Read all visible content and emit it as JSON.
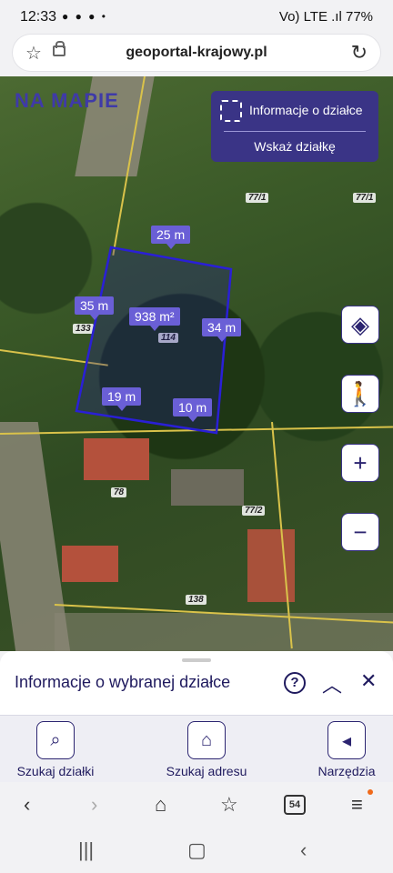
{
  "status": {
    "time": "12:33",
    "notifications": "● ● ● •",
    "right": "Vo) LTE .ıl 77%"
  },
  "browser": {
    "url": "geoportal-krajowy.pl",
    "tabs_count": "54"
  },
  "map": {
    "logo": "NA MAPIE",
    "info_panel": {
      "title": "Informacje o działce",
      "subtitle": "Wskaż działkę"
    },
    "measurements": {
      "top": "25 m",
      "left": "35 m",
      "area": "938 m²",
      "right": "34 m",
      "bottom_left": "19 m",
      "bottom_right": "10 m"
    },
    "plot_numbers": [
      "77/1",
      "77/1",
      "133",
      "114",
      "78",
      "77/2",
      "138"
    ]
  },
  "sheet": {
    "title": "Informacje o wybranej działce"
  },
  "toolbar": {
    "search_plot": "Szukaj działki",
    "search_address": "Szukaj adresu",
    "tools": "Narzędzia"
  },
  "colors": {
    "accent": "#3a3486",
    "polygon": "#2a1fd6",
    "dim_label": "#6a5fd6"
  }
}
